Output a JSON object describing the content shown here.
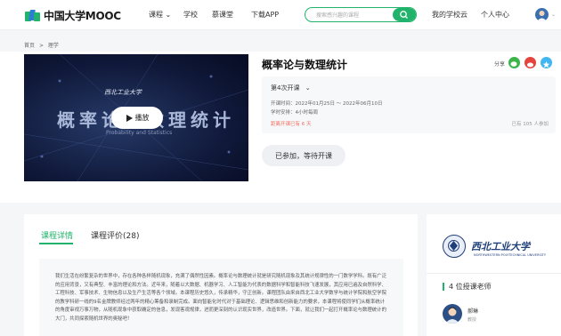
{
  "header": {
    "logo_text": "中国大学MOOC",
    "nav": [
      "课程",
      "学校",
      "慕课堂",
      "下载APP"
    ],
    "search_placeholder": "搜索感兴趣的课程",
    "my_school": "我的学校云",
    "personal_center": "个人中心",
    "brand_color": "#21b36b"
  },
  "breadcrumb": {
    "home": "首页",
    "sep": ">",
    "category": "理学"
  },
  "video": {
    "title_overlay": "概率论与数理统计",
    "subtitle_overlay": "Probability and Statistics",
    "logo_overlay": "西北工业大学",
    "play_label": "播放"
  },
  "course": {
    "title": "概率论与数理统计",
    "share_label": "分享",
    "term": "第4次开课",
    "term_chevron": "⌄",
    "time_label": "开课时间：",
    "time_value": "2022年01月25日 ～ 2022年06月10日",
    "workload_label": "学时安排：",
    "workload_value": "4小时每周",
    "started_notice": "距离开课已有 6 天",
    "enrolled_count": "已有 105 人参加",
    "enroll_button": "已参加，等待开课"
  },
  "detail": {
    "tabs": [
      "课程详情",
      "课程评价(28)"
    ],
    "active_tab": 0,
    "description": "我们生活在纷繁复杂的世界中，存在各种各样随机现象，充满了偶然性因素。概率论与数理统计就是研究随机现象及其统计规律性的一门数学学科。既有广泛的应用背景，又有典型、丰富的理论和方法。近年来，随着以大数据、机器学习、人工智能为代表的数据科学和智能科技飞速发展，其应用已遍及自然科学、工程科技、军事技术、生物信息以及生产生活等各个领域。本课程历史悠久，传承精华，守正创新。课程团队由来自西北工业大学数学与统计学院和航空学院的教学科研一线的9名金牌教师经过两年的精心筹备和录制完成。面向智能化时代对于基础理论、逻辑思维和创新能力的要求，本课程将使同学们从概率统计的角度审视万事万物，从随机现象中获取确定的信息，发现客观规律，进而更深刻的认识现实世界，改造世界。下面，就让我们一起打开概率论与数理统计的大门，共同探索随机世界的奥秘吧！"
  },
  "sidebar": {
    "school_name": "西北工业大学",
    "school_en": "NORTHWESTERN POLYTECHNICAL UNIVERSITY",
    "teacher_count": "4 位授课老师",
    "teacher_name": "郝琳",
    "teacher_role": "教授"
  }
}
